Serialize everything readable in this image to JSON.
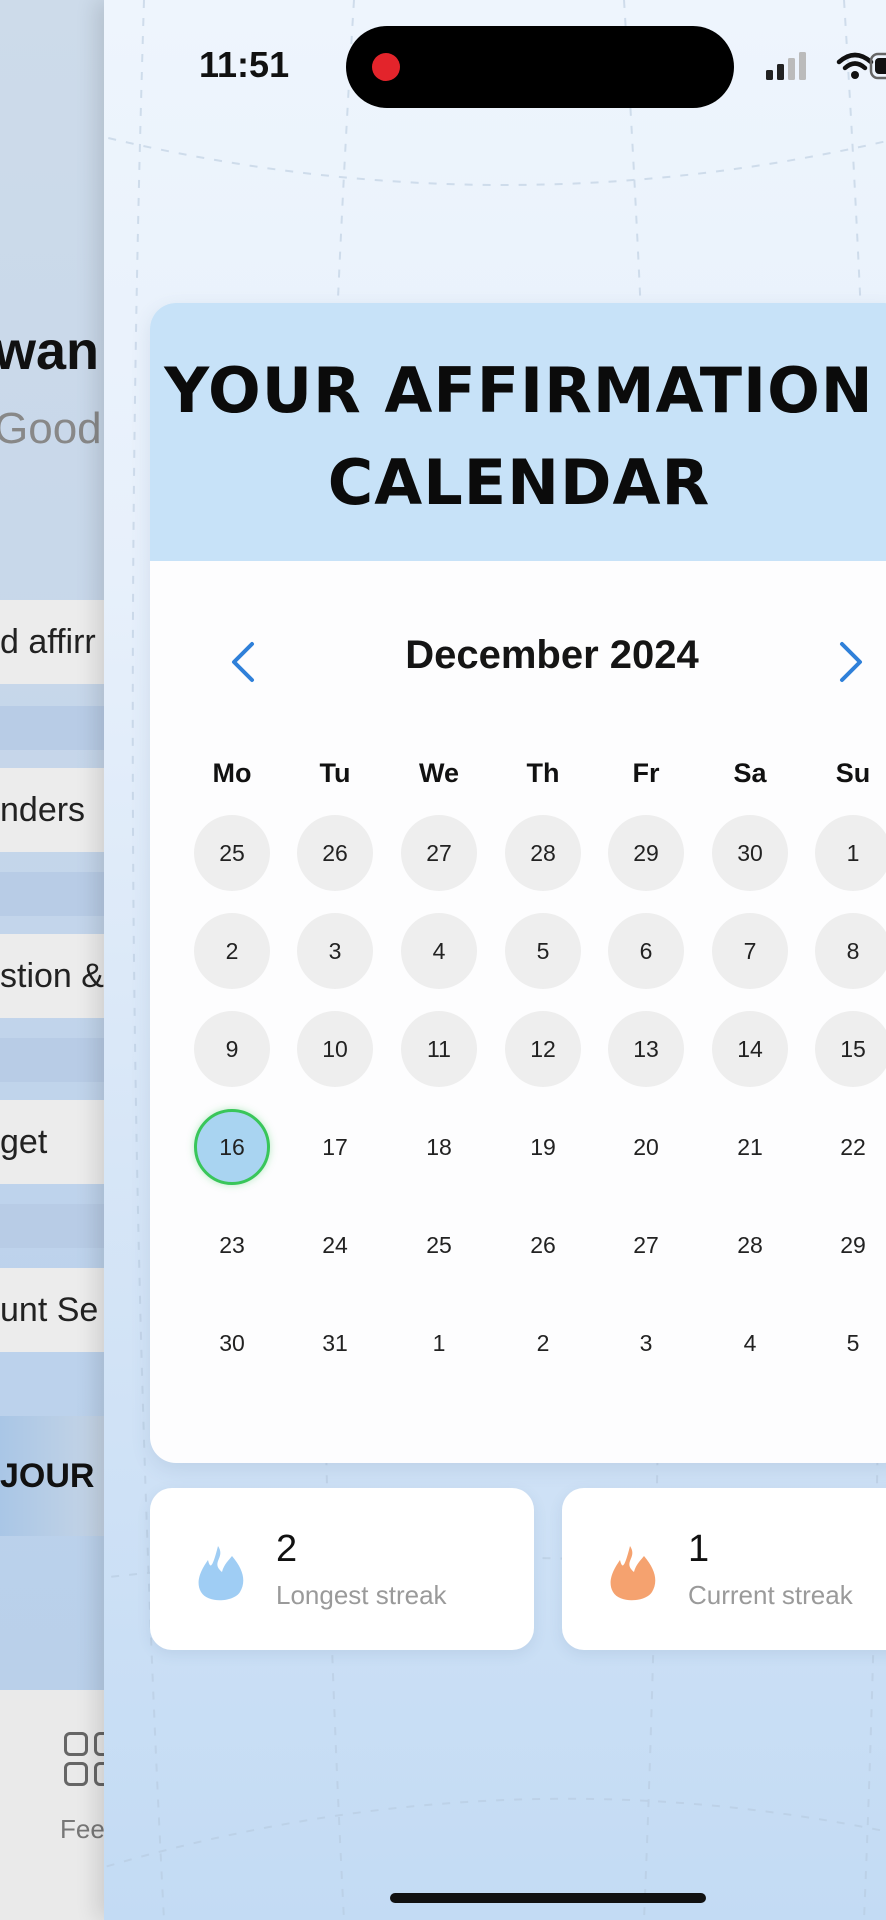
{
  "status_bar": {
    "time": "11:51"
  },
  "background_screen": {
    "greeting": "wan",
    "subtitle": "Good",
    "menu_items": [
      "d affirr",
      "nders",
      "stion &",
      "get",
      "unt Se"
    ],
    "journey_button": "JOUR",
    "tab_label": "Fee"
  },
  "calendar": {
    "title_line1": "YOUR AFFIRMATION",
    "title_line2": "CALENDAR",
    "month_label": "December 2024",
    "weekdays": [
      "Mo",
      "Tu",
      "We",
      "Th",
      "Fr",
      "Sa",
      "Su"
    ],
    "weeks": [
      [
        "25",
        "26",
        "27",
        "28",
        "29",
        "30",
        "1"
      ],
      [
        "2",
        "3",
        "4",
        "5",
        "6",
        "7",
        "8"
      ],
      [
        "9",
        "10",
        "11",
        "12",
        "13",
        "14",
        "15"
      ],
      [
        "16",
        "17",
        "18",
        "19",
        "20",
        "21",
        "22"
      ],
      [
        "23",
        "24",
        "25",
        "26",
        "27",
        "28",
        "29"
      ],
      [
        "30",
        "31",
        "1",
        "2",
        "3",
        "4",
        "5"
      ]
    ],
    "today": "16",
    "past_days_shaded_weeks": 3
  },
  "streaks": {
    "longest": {
      "value": "2",
      "label": "Longest streak",
      "color": "#9fcdf4"
    },
    "current": {
      "value": "1",
      "label": "Current streak",
      "color": "#f5a26f"
    }
  },
  "colors": {
    "accent_blue": "#2f80d9",
    "header_bg": "#c7e2f8",
    "today_ring": "#39c65a"
  },
  "icons": [
    "close-icon",
    "chevron-left-icon",
    "chevron-right-icon",
    "flame-icon",
    "wifi-icon",
    "signal-icon",
    "battery-icon"
  ]
}
